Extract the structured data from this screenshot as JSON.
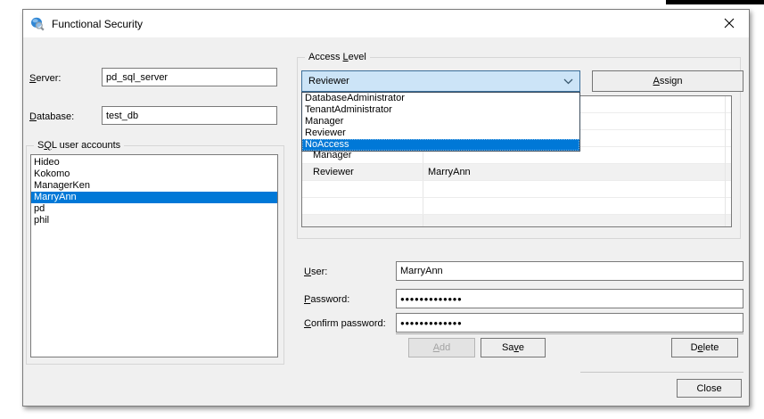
{
  "window": {
    "title": "Functional Security"
  },
  "server": {
    "label": {
      "t": "Server:",
      "k": 0
    },
    "value": "pd_sql_server"
  },
  "database": {
    "label": {
      "t": "Database:",
      "k": 0
    },
    "value": "test_db"
  },
  "accounts": {
    "title": {
      "t": "SQL user accounts",
      "k": 1
    },
    "items": [
      "Hideo",
      "Kokomo",
      "ManagerKen",
      "MarryAnn",
      "pd",
      "phil"
    ],
    "selected": "MarryAnn"
  },
  "access": {
    "title": {
      "t": "Access Level",
      "k": 7
    },
    "combo_value": "Reviewer",
    "assign_label": {
      "t": "Assign",
      "k": 0
    },
    "options": [
      "DatabaseAdministrator",
      "TenantAdministrator",
      "Manager",
      "Reviewer",
      "NoAccess"
    ],
    "highlighted_option": "NoAccess",
    "grid": {
      "rows": [
        {
          "level": "",
          "user": ""
        },
        {
          "level": "",
          "user": ""
        },
        {
          "level": "",
          "user": ""
        },
        {
          "level": "Manager",
          "user": ""
        },
        {
          "level": "Reviewer",
          "user": "MarryAnn"
        },
        {
          "level": "",
          "user": ""
        },
        {
          "level": "",
          "user": ""
        },
        {
          "level": "",
          "user": ""
        }
      ]
    }
  },
  "user_form": {
    "user": {
      "label": {
        "t": "User:",
        "k": 0
      },
      "value": "MarryAnn"
    },
    "password": {
      "label": {
        "t": "Password:",
        "k": 0
      },
      "value": "●●●●●●●●●●●●●"
    },
    "confirm": {
      "label": {
        "t": "Confirm password:",
        "k": 0
      },
      "value": "●●●●●●●●●●●●●"
    }
  },
  "buttons": {
    "add": {
      "t": "Add",
      "k": 0
    },
    "save": {
      "t": "Save",
      "k": 2
    },
    "delete": {
      "t": "Delete",
      "k": 1
    },
    "close": {
      "t": "Close",
      "k": null
    }
  }
}
